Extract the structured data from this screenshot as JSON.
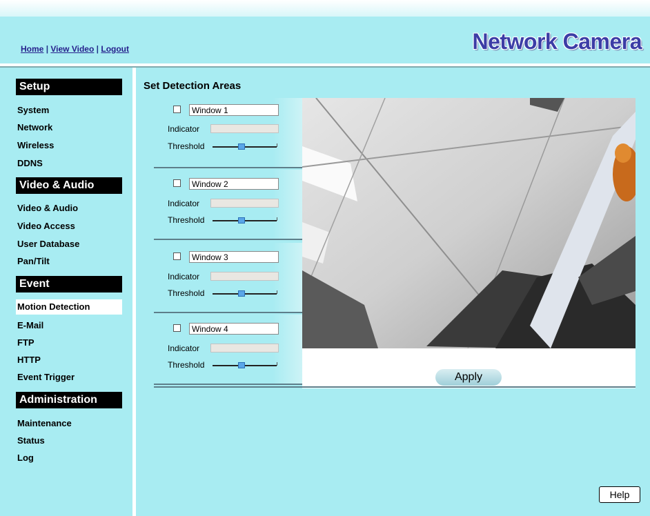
{
  "header": {
    "links": [
      "Home",
      "View Video",
      "Logout"
    ],
    "separator": "|",
    "brand": "Network Camera"
  },
  "sidebar": {
    "sections": [
      {
        "title": "Setup",
        "items": [
          "System",
          "Network",
          "Wireless",
          "DDNS"
        ]
      },
      {
        "title": "Video & Audio",
        "items": [
          "Video & Audio",
          "Video Access",
          "User Database",
          "Pan/Tilt"
        ]
      },
      {
        "title": "Event",
        "items": [
          "Motion Detection",
          "E-Mail",
          "FTP",
          "HTTP",
          "Event Trigger"
        ]
      },
      {
        "title": "Administration",
        "items": [
          "Maintenance",
          "Status",
          "Log"
        ]
      }
    ],
    "active_item": "Motion Detection"
  },
  "main": {
    "title": "Set Detection Areas",
    "indicator_label": "Indicator",
    "threshold_label": "Threshold",
    "windows": [
      {
        "name": "Window 1",
        "enabled": false,
        "threshold": 0.45
      },
      {
        "name": "Window 2",
        "enabled": false,
        "threshold": 0.45
      },
      {
        "name": "Window 3",
        "enabled": false,
        "threshold": 0.45
      },
      {
        "name": "Window 4",
        "enabled": false,
        "threshold": 0.45
      }
    ],
    "apply_label": "Apply",
    "help_label": "Help"
  },
  "colors": {
    "background": "#a8ecf2",
    "brand": "#3c3da6",
    "section_head": "#000000",
    "link": "#26208c",
    "slider_thumb": "#5aa6e8"
  }
}
